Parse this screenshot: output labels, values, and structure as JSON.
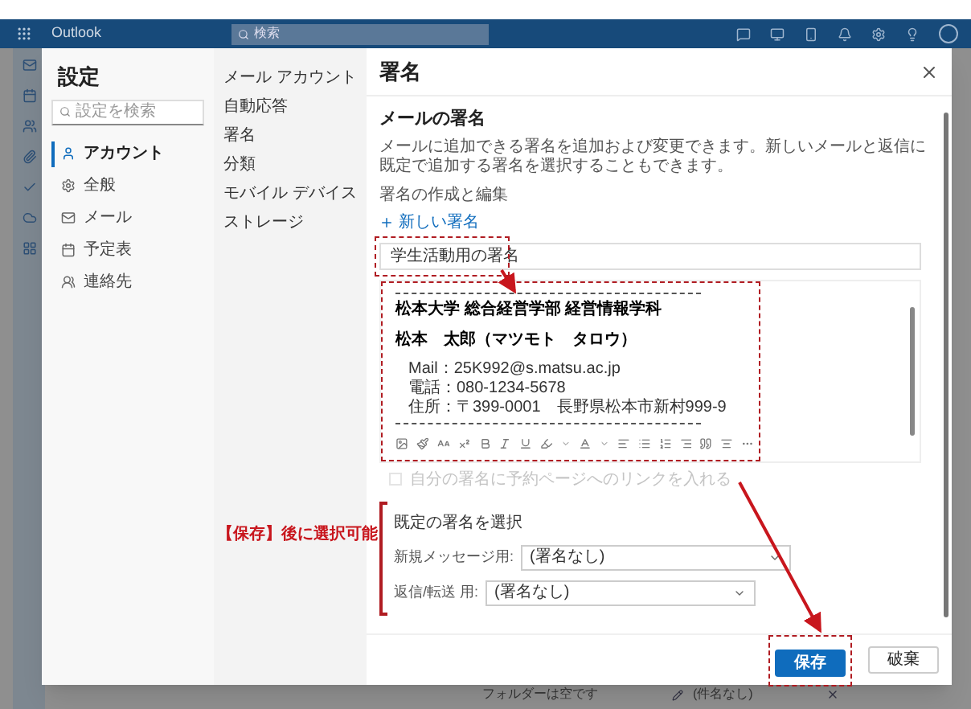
{
  "app_bar": {
    "brand": "Outlook",
    "search": {
      "placeholder": "検索"
    }
  },
  "settings": {
    "title": "設定",
    "search": {
      "placeholder": "設定を検索"
    },
    "categories": [
      {
        "label": "アカウント",
        "selected": true
      },
      {
        "label": "全般",
        "selected": false
      },
      {
        "label": "メール",
        "selected": false
      },
      {
        "label": "予定表",
        "selected": false
      },
      {
        "label": "連絡先",
        "selected": false
      }
    ]
  },
  "subcategories": [
    "メール アカウント",
    "自動応答",
    "署名",
    "分類",
    "モバイル デバイス",
    "ストレージ"
  ],
  "panel": {
    "title": "署名",
    "section_title": "メールの署名",
    "description": "メールに追加できる署名を追加および変更できます。新しいメールと返信に既定で追加する署名を選択することもできます。",
    "edit_label": "署名の作成と編集",
    "new_button": "新しい署名",
    "name_field": {
      "value": "学生活動用の署名"
    },
    "editor_lines": [
      {
        "kind": "rule"
      },
      {
        "kind": "heading",
        "text": "松本大学 総合経営学部 経営情報学科"
      },
      {
        "kind": "heading",
        "text": "松本　太郎（マツモト　タロウ）"
      },
      {
        "kind": "detail",
        "text": "Mail：25K992@s.matsu.ac.jp"
      },
      {
        "kind": "detail",
        "text": "電話：080-1234-5678"
      },
      {
        "kind": "detail",
        "text": "住所：〒399-0001　長野県松本市新村999-9"
      },
      {
        "kind": "rule"
      }
    ],
    "booking_link": {
      "label": "自分の署名に予約ページへのリンクを入れる",
      "checked": false,
      "disabled": true
    },
    "defaults": {
      "title": "既定の署名を選択",
      "selects": [
        {
          "label": "新規メッセージ用:",
          "value": "(署名なし)"
        },
        {
          "label": "返信/転送 用:",
          "value": "(署名なし)"
        }
      ]
    },
    "buttons": [
      {
        "label": "保存",
        "kind": "primary"
      },
      {
        "label": "破棄",
        "kind": "secondary"
      }
    ]
  },
  "annotation": {
    "note": "【保存】後に選択可能"
  },
  "background_list": {
    "status": "フォルダーは空です",
    "draft": "(件名なし)"
  }
}
